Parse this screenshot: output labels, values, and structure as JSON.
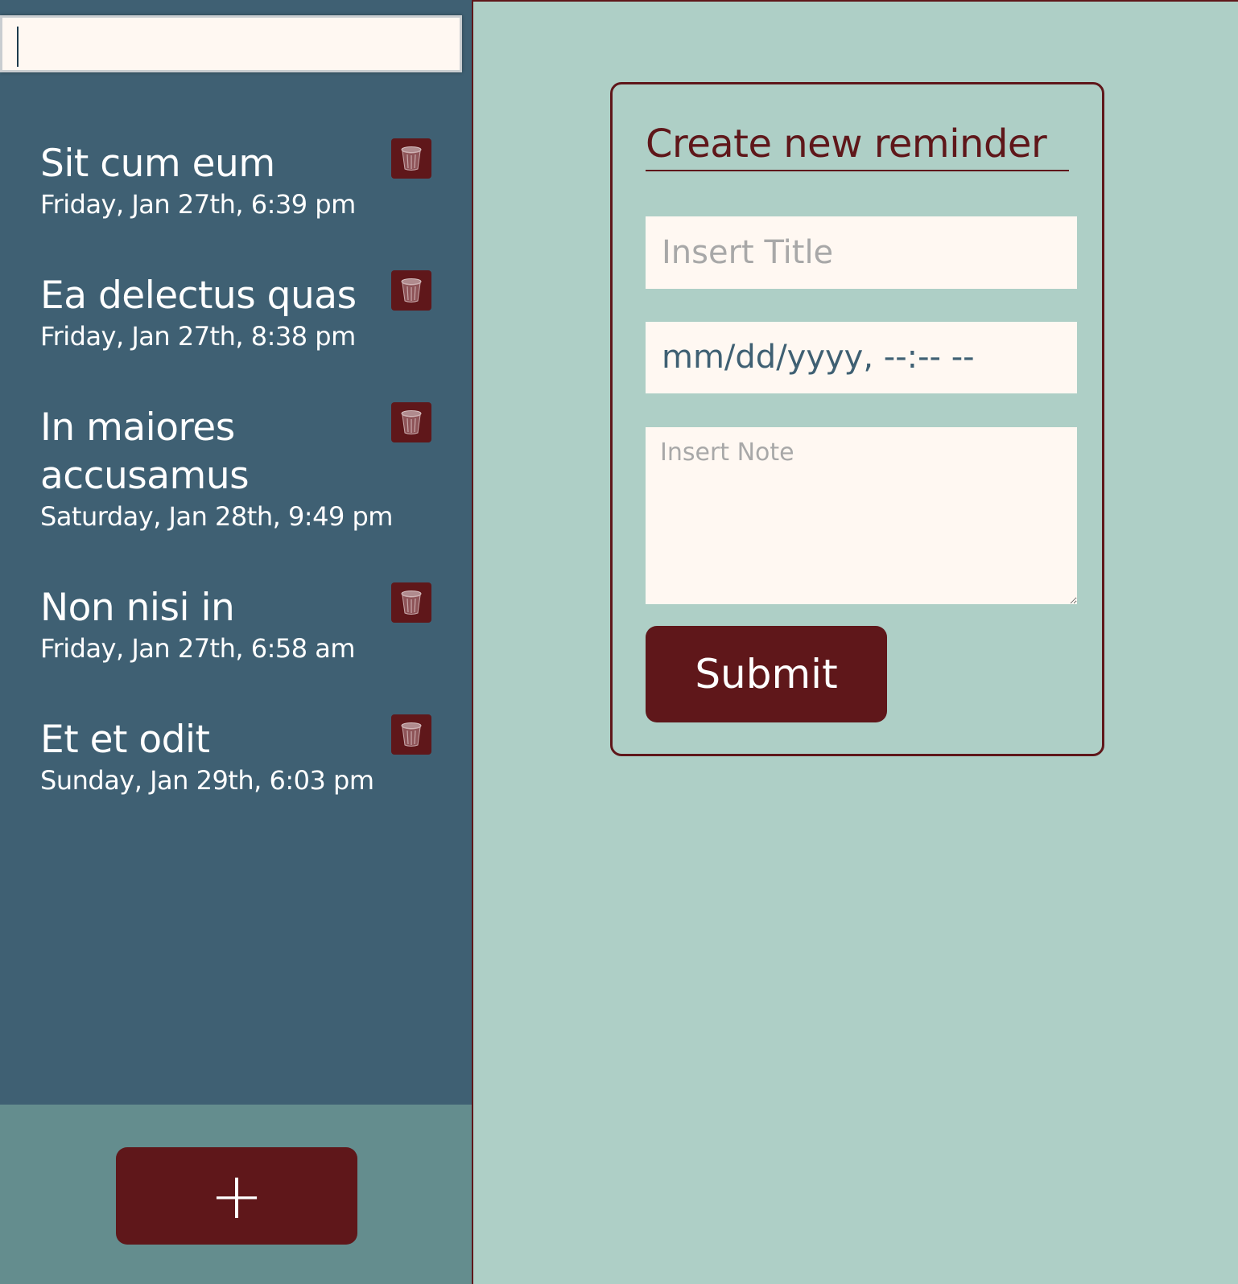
{
  "colors": {
    "sidebar_bg": "#3f6073",
    "main_bg": "#aecfc6",
    "footer_bg": "#648d8e",
    "accent": "#5f171a",
    "field_bg": "#fff8f2"
  },
  "search": {
    "value": "",
    "placeholder": ""
  },
  "reminders": [
    {
      "title": "Sit cum eum",
      "date": "Friday, Jan 27th, 6:39 pm",
      "delete_icon": "trash-icon"
    },
    {
      "title": "Ea delectus quas",
      "date": "Friday, Jan 27th, 8:38 pm",
      "delete_icon": "trash-icon"
    },
    {
      "title": "In maiores accusamus",
      "date": "Saturday, Jan 28th, 9:49 pm",
      "delete_icon": "trash-icon"
    },
    {
      "title": "Non nisi in",
      "date": "Friday, Jan 27th, 6:58 am",
      "delete_icon": "trash-icon"
    },
    {
      "title": "Et et odit",
      "date": "Sunday, Jan 29th, 6:03 pm",
      "delete_icon": "trash-icon"
    }
  ],
  "footer": {
    "add_label": "+"
  },
  "form": {
    "heading": "Create new reminder",
    "title_placeholder": "Insert Title",
    "title_value": "",
    "datetime_display": "mm/dd/yyyy, --:-- --",
    "note_placeholder": "Insert Note",
    "note_value": "",
    "submit_label": "Submit"
  }
}
